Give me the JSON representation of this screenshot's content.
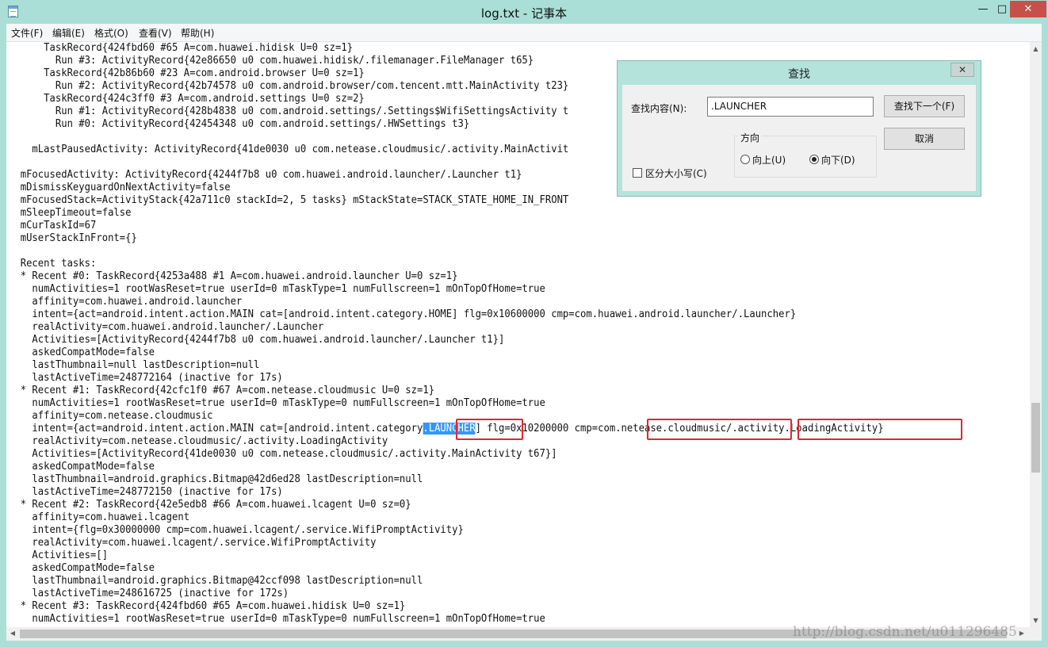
{
  "window": {
    "title": "log.txt - 记事本",
    "min_glyph": "—",
    "max_glyph": "□",
    "close_glyph": "✕"
  },
  "menu": {
    "items": [
      "文件(F)",
      "编辑(E)",
      "格式(O)",
      "查看(V)",
      "帮助(H)"
    ]
  },
  "content": {
    "lines": [
      "      TaskRecord{424fbd60 #65 A=com.huawei.hidisk U=0 sz=1}",
      "        Run #3: ActivityRecord{42e86650 u0 com.huawei.hidisk/.filemanager.FileManager t65}",
      "      TaskRecord{42b86b60 #23 A=com.android.browser U=0 sz=1}",
      "        Run #2: ActivityRecord{42b74578 u0 com.android.browser/com.tencent.mtt.MainActivity t23}",
      "      TaskRecord{424c3ff0 #3 A=com.android.settings U=0 sz=2}",
      "        Run #1: ActivityRecord{428b4838 u0 com.android.settings/.Settings$WifiSettingsActivity t",
      "        Run #0: ActivityRecord{42454348 u0 com.android.settings/.HWSettings t3}",
      "",
      "    mLastPausedActivity: ActivityRecord{41de0030 u0 com.netease.cloudmusic/.activity.MainActivit",
      "",
      "  mFocusedActivity: ActivityRecord{4244f7b8 u0 com.huawei.android.launcher/.Launcher t1}",
      "  mDismissKeyguardOnNextActivity=false",
      "  mFocusedStack=ActivityStack{42a711c0 stackId=2, 5 tasks} mStackState=STACK_STATE_HOME_IN_FRONT",
      "  mSleepTimeout=false",
      "  mCurTaskId=67",
      "  mUserStackInFront={}",
      "",
      "  Recent tasks:",
      "  * Recent #0: TaskRecord{4253a488 #1 A=com.huawei.android.launcher U=0 sz=1}",
      "    numActivities=1 rootWasReset=true userId=0 mTaskType=1 numFullscreen=1 mOnTopOfHome=true",
      "    affinity=com.huawei.android.launcher",
      "    intent={act=android.intent.action.MAIN cat=[android.intent.category.HOME] flg=0x10600000 cmp=com.huawei.android.launcher/.Launcher}",
      "    realActivity=com.huawei.android.launcher/.Launcher",
      "    Activities=[ActivityRecord{4244f7b8 u0 com.huawei.android.launcher/.Launcher t1}]",
      "    askedCompatMode=false",
      "    lastThumbnail=null lastDescription=null",
      "    lastActiveTime=248772164 (inactive for 17s)",
      "  * Recent #1: TaskRecord{42cfc1f0 #67 A=com.netease.cloudmusic U=0 sz=1}",
      "    numActivities=1 rootWasReset=true userId=0 mTaskType=0 numFullscreen=1 mOnTopOfHome=true",
      "    affinity=com.netease.cloudmusic",
      "__INTENT__",
      "    realActivity=com.netease.cloudmusic/.activity.LoadingActivity",
      "    Activities=[ActivityRecord{41de0030 u0 com.netease.cloudmusic/.activity.MainActivity t67}]",
      "    askedCompatMode=false",
      "    lastThumbnail=android.graphics.Bitmap@42d6ed28 lastDescription=null",
      "    lastActiveTime=248772150 (inactive for 17s)",
      "  * Recent #2: TaskRecord{42e5edb8 #66 A=com.huawei.lcagent U=0 sz=0}",
      "    affinity=com.huawei.lcagent",
      "    intent={flg=0x30000000 cmp=com.huawei.lcagent/.service.WifiPromptActivity}",
      "    realActivity=com.huawei.lcagent/.service.WifiPromptActivity",
      "    Activities=[]",
      "    askedCompatMode=false",
      "    lastThumbnail=android.graphics.Bitmap@42ccf098 lastDescription=null",
      "    lastActiveTime=248616725 (inactive for 172s)",
      "  * Recent #3: TaskRecord{424fbd60 #65 A=com.huawei.hidisk U=0 sz=1}",
      "    numActivities=1 rootWasReset=true userId=0 mTaskType=0 numFullscreen=1 mOnTopOfHome=true"
    ],
    "intent_line": {
      "pre": "    intent={act=android.intent.action.MAIN cat=[android.intent.category",
      "selected": ".LAUNCHER",
      "mid": "] flg=0x10200000 cmp=",
      "pkg": "com.netease.cloudmusic",
      "slash": "/",
      "activity": ".activity.LoadingActivity}"
    }
  },
  "find_dialog": {
    "title": "查找",
    "close_glyph": "✕",
    "find_label": "查找内容(N):",
    "find_value": ".LAUNCHER",
    "find_next": "查找下一个(F)",
    "cancel": "取消",
    "direction_label": "方向",
    "up_label": "向上(U)",
    "down_label": "向下(D)",
    "match_case_label": "区分大小写(C)",
    "direction_selected": "down",
    "match_case_checked": false
  },
  "scrollbar": {
    "up_glyph": "▲",
    "down_glyph": "▼",
    "left_glyph": "◀",
    "right_glyph": "▶"
  },
  "watermark": "http://blog.csdn.net/u011296485",
  "highlight_color": "#e3262e",
  "selection_color": "#3297fd"
}
